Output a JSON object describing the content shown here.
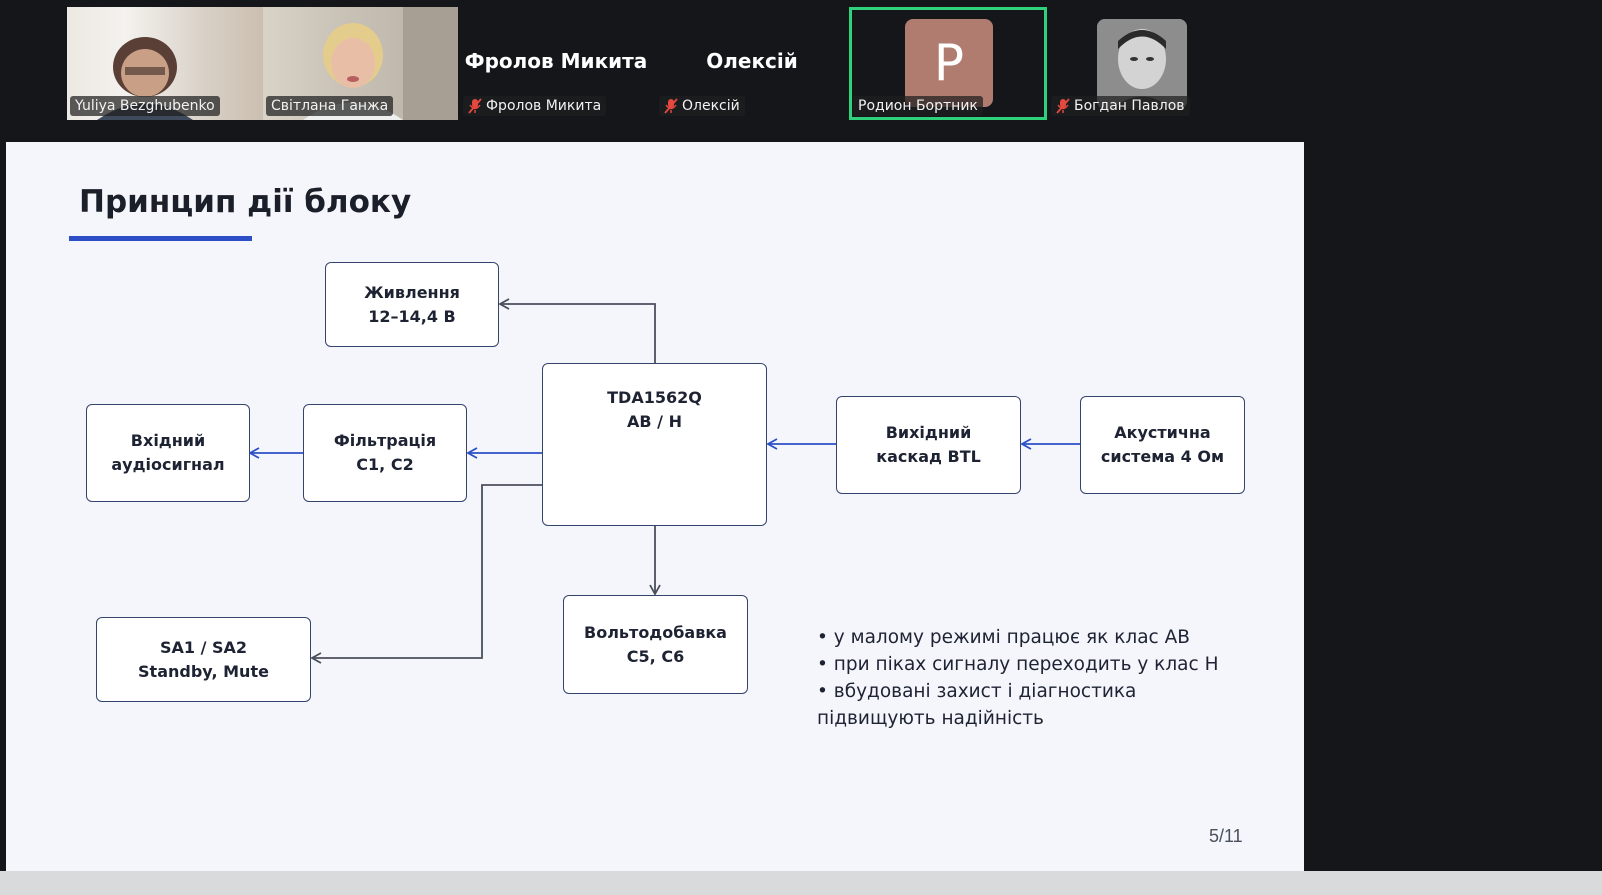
{
  "participants": [
    {
      "name": "Yuliya Bezghubenko",
      "type": "video",
      "muted": false
    },
    {
      "name": "Світлана Ганжа",
      "type": "video",
      "muted": false
    },
    {
      "name": "Фролов Микита",
      "display": "Фролов Микита",
      "type": "name",
      "muted": true
    },
    {
      "name": "Олексій",
      "display": "Олексій",
      "type": "name",
      "muted": true
    },
    {
      "name": "Родион Бортник",
      "initial": "P",
      "type": "avatar",
      "muted": false,
      "active": true
    },
    {
      "name": "Богдан Павлов",
      "type": "photo",
      "muted": true
    }
  ],
  "slide": {
    "title": "Принцип дії блоку",
    "blocks": {
      "power": {
        "line1": "Живлення",
        "line2": "12–14,4 В"
      },
      "chip": {
        "line1": "TDA1562Q",
        "line2": "AB / H"
      },
      "input": {
        "line1": "Вхідний",
        "line2": "аудіосигнал"
      },
      "filter": {
        "line1": "Фільтрація",
        "line2": "C1, C2"
      },
      "output": {
        "line1": "Вихідний",
        "line2": "каскад BTL"
      },
      "speaker": {
        "line1": "Акустична",
        "line2": "система 4 Ом"
      },
      "switch": {
        "line1": "SA1 / SA2",
        "line2": "Standby, Mute"
      },
      "boost": {
        "line1": "Вольтодобавка",
        "line2": "C5, C6"
      }
    },
    "bullets": [
      "• у малому режимі працює як клас AB",
      "• при піках сигналу переходить у клас H",
      "• вбудовані захист і діагностика",
      "підвищують надійність"
    ],
    "page_number": "5/11"
  },
  "colors": {
    "accent": "#2c4fc8",
    "active_speaker": "#2fd27a",
    "muted_icon": "#e5483e",
    "avatar_bg": "#b07c70"
  }
}
